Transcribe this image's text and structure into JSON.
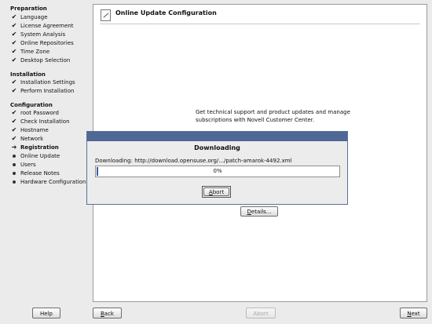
{
  "sidebar": {
    "preparation": {
      "title": "Preparation",
      "items": [
        {
          "label": "Language",
          "state": "done"
        },
        {
          "label": "License Agreement",
          "state": "done"
        },
        {
          "label": "System Analysis",
          "state": "done"
        },
        {
          "label": "Online Repositories",
          "state": "done"
        },
        {
          "label": "Time Zone",
          "state": "done"
        },
        {
          "label": "Desktop Selection",
          "state": "done"
        }
      ]
    },
    "installation": {
      "title": "Installation",
      "items": [
        {
          "label": "Installation Settings",
          "state": "done"
        },
        {
          "label": "Perform Installation",
          "state": "done"
        }
      ]
    },
    "configuration": {
      "title": "Configuration",
      "items": [
        {
          "label": "root Password",
          "state": "done"
        },
        {
          "label": "Check Installation",
          "state": "done"
        },
        {
          "label": "Hostname",
          "state": "done"
        },
        {
          "label": "Network",
          "state": "done"
        },
        {
          "label": "Registration",
          "state": "current"
        },
        {
          "label": "Online Update",
          "state": "pending"
        },
        {
          "label": "Users",
          "state": "pending"
        },
        {
          "label": "Release Notes",
          "state": "pending"
        },
        {
          "label": "Hardware Configuration",
          "state": "pending"
        }
      ]
    },
    "icons": {
      "done": "check-icon",
      "current": "arrow-right-icon",
      "pending": "bullet-icon"
    }
  },
  "main": {
    "title": "Online Update Configuration",
    "title_icon": "edit-document-icon",
    "info_text": "Get technical support and product updates and manage subscriptions with Novell Customer Center.",
    "details_button": {
      "mnemonic": "D",
      "rest": "etails..."
    }
  },
  "dialog": {
    "heading": "Downloading",
    "url_text": "Downloading: http://download.opensuse.org/.../patch-amarok-4492.xml",
    "progress_value": 0,
    "progress_text": "0%",
    "abort_button": {
      "mnemonic": "A",
      "rest": "bort"
    },
    "colors": {
      "titlebar": "#506896",
      "progress": "#3b5a9a"
    }
  },
  "footer": {
    "help": "Help",
    "back": {
      "mnemonic": "B",
      "rest": "ack"
    },
    "abort": "Abort",
    "next": {
      "mnemonic": "N",
      "rest": "ext"
    }
  }
}
